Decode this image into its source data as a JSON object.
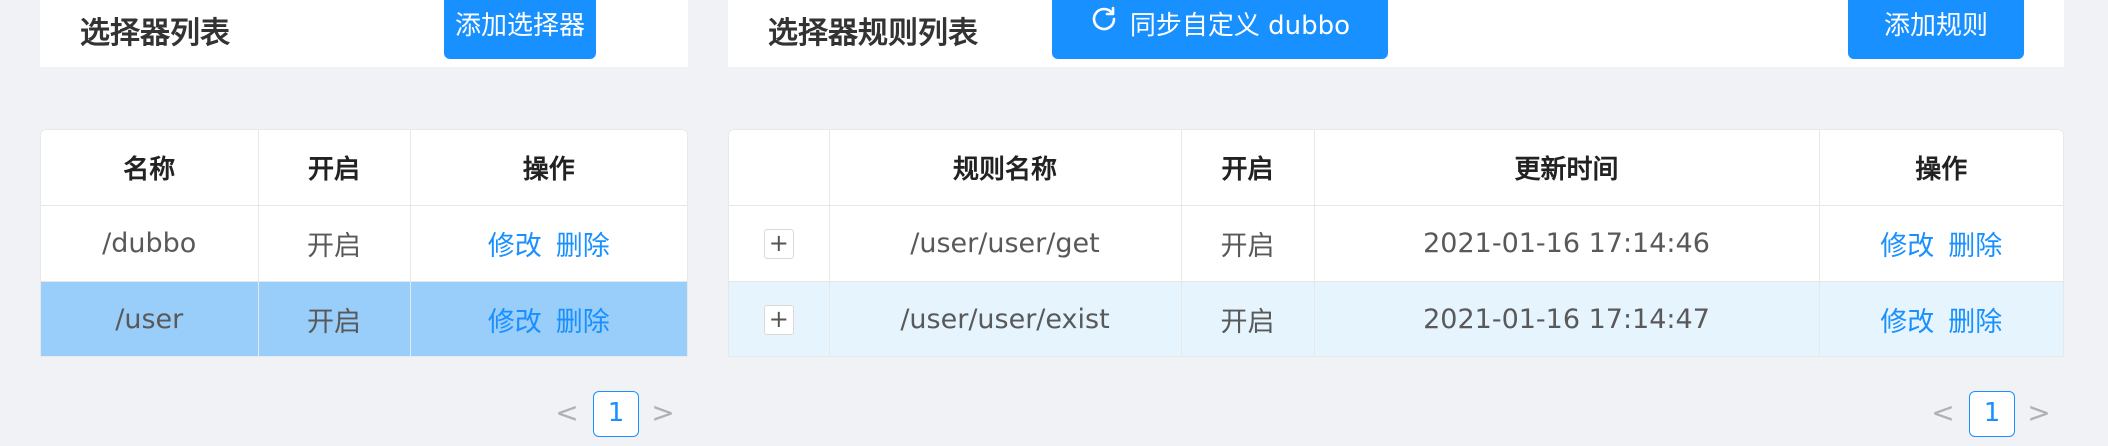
{
  "left_panel": {
    "title": "选择器列表",
    "add_button": "添加选择器",
    "columns": [
      "名称",
      "开启",
      "操作"
    ],
    "rows": [
      {
        "name": "/dubbo",
        "status": "开启",
        "edit": "修改",
        "delete": "删除",
        "selected": false
      },
      {
        "name": "/user",
        "status": "开启",
        "edit": "修改",
        "delete": "删除",
        "selected": true
      }
    ],
    "pagination": {
      "prev": "<",
      "current": "1",
      "next": ">"
    }
  },
  "right_panel": {
    "title": "选择器规则列表",
    "sync_button": "同步自定义 dubbo",
    "add_button": "添加规则",
    "columns": [
      "",
      "规则名称",
      "开启",
      "更新时间",
      "操作"
    ],
    "rows": [
      {
        "expand": "+",
        "name": "/user/user/get",
        "status": "开启",
        "updated": "2021-01-16 17:14:46",
        "edit": "修改",
        "delete": "删除"
      },
      {
        "expand": "+",
        "name": "/user/user/exist",
        "status": "开启",
        "updated": "2021-01-16 17:14:47",
        "edit": "修改",
        "delete": "删除"
      }
    ],
    "pagination": {
      "prev": "<",
      "current": "1",
      "next": ">"
    }
  },
  "icons": {
    "sync": "sync-icon",
    "prev": "chevron-left-icon",
    "next": "chevron-right-icon",
    "expand": "plus-icon"
  },
  "colors": {
    "primary": "#1890ff",
    "status_on": "#19be6b",
    "selected_row": "#99cdfa",
    "hover_row": "#e6f4fd",
    "background": "#f0f2f5"
  }
}
